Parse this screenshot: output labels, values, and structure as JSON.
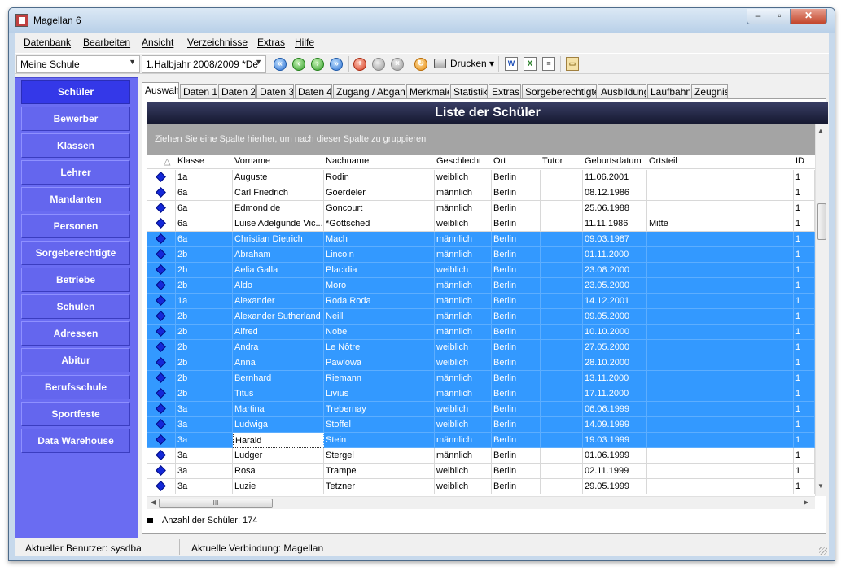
{
  "window": {
    "title": "Magellan 6"
  },
  "menu": [
    "Datenbank",
    "Bearbeiten",
    "Ansicht",
    "Verzeichnisse",
    "Extras",
    "Hilfe"
  ],
  "toolbar": {
    "school": "Meine Schule",
    "period": "1.Halbjahr 2008/2009 *De",
    "print_label": "Drucken"
  },
  "sidebar": {
    "active": "Schüler",
    "items": [
      "Schüler",
      "Bewerber",
      "Klassen",
      "Lehrer",
      "Mandanten",
      "Personen",
      "Sorgeberechtigte",
      "Betriebe",
      "Schulen",
      "Adressen",
      "Abitur",
      "Berufsschule",
      "Sportfeste",
      "Data Warehouse"
    ]
  },
  "tabs": {
    "active": "Auswahl",
    "items": [
      "Auswahl",
      "Daten 1",
      "Daten 2",
      "Daten 3",
      "Daten 4",
      "Zugang / Abgang",
      "Merkmale",
      "Statistik",
      "Extras",
      "Sorgeberechtigte",
      "Ausbildung",
      "Laufbahn",
      "Zeugnis"
    ]
  },
  "list": {
    "title": "Liste der Schüler",
    "group_hint": "Ziehen Sie eine Spalte hierher, um nach dieser Spalte zu gruppieren",
    "sort_indicator": "△",
    "columns": [
      "Klasse",
      "Vorname",
      "Nachname",
      "Geschlecht",
      "Ort",
      "Tutor",
      "Geburtsdatum",
      "Ortsteil",
      "ID"
    ],
    "rows": [
      {
        "klasse": "1a",
        "vorname": "Auguste",
        "nachname": "Rodin",
        "geschlecht": "weiblich",
        "ort": "Berlin",
        "tutor": "",
        "geburtsdatum": "11.06.2001",
        "ortsteil": "",
        "id": "1",
        "selected": false
      },
      {
        "klasse": "6a",
        "vorname": "Carl Friedrich",
        "nachname": "Goerdeler",
        "geschlecht": "männlich",
        "ort": "Berlin",
        "tutor": "",
        "geburtsdatum": "08.12.1986",
        "ortsteil": "",
        "id": "1",
        "selected": false
      },
      {
        "klasse": "6a",
        "vorname": "Edmond de",
        "nachname": "Goncourt",
        "geschlecht": "männlich",
        "ort": "Berlin",
        "tutor": "",
        "geburtsdatum": "25.06.1988",
        "ortsteil": "",
        "id": "1",
        "selected": false
      },
      {
        "klasse": "6a",
        "vorname": "Luise Adelgunde Vic...",
        "nachname": "*Gottsched",
        "geschlecht": "weiblich",
        "ort": "Berlin",
        "tutor": "",
        "geburtsdatum": "11.11.1986",
        "ortsteil": "Mitte",
        "id": "1",
        "selected": false
      },
      {
        "klasse": "6a",
        "vorname": "Christian Dietrich",
        "nachname": "Mach",
        "geschlecht": "männlich",
        "ort": "Berlin",
        "tutor": "",
        "geburtsdatum": "09.03.1987",
        "ortsteil": "",
        "id": "1",
        "selected": true
      },
      {
        "klasse": "2b",
        "vorname": "Abraham",
        "nachname": "Lincoln",
        "geschlecht": "männlich",
        "ort": "Berlin",
        "tutor": "",
        "geburtsdatum": "01.11.2000",
        "ortsteil": "",
        "id": "1",
        "selected": true
      },
      {
        "klasse": "2b",
        "vorname": "Aelia Galla",
        "nachname": "Placidia",
        "geschlecht": "weiblich",
        "ort": "Berlin",
        "tutor": "",
        "geburtsdatum": "23.08.2000",
        "ortsteil": "",
        "id": "1",
        "selected": true
      },
      {
        "klasse": "2b",
        "vorname": "Aldo",
        "nachname": "Moro",
        "geschlecht": "männlich",
        "ort": "Berlin",
        "tutor": "",
        "geburtsdatum": "23.05.2000",
        "ortsteil": "",
        "id": "1",
        "selected": true
      },
      {
        "klasse": "1a",
        "vorname": "Alexander",
        "nachname": "Roda Roda",
        "geschlecht": "männlich",
        "ort": "Berlin",
        "tutor": "",
        "geburtsdatum": "14.12.2001",
        "ortsteil": "",
        "id": "1",
        "selected": true
      },
      {
        "klasse": "2b",
        "vorname": "Alexander Sutherland",
        "nachname": "Neill",
        "geschlecht": "männlich",
        "ort": "Berlin",
        "tutor": "",
        "geburtsdatum": "09.05.2000",
        "ortsteil": "",
        "id": "1",
        "selected": true
      },
      {
        "klasse": "2b",
        "vorname": "Alfred",
        "nachname": "Nobel",
        "geschlecht": "männlich",
        "ort": "Berlin",
        "tutor": "",
        "geburtsdatum": "10.10.2000",
        "ortsteil": "",
        "id": "1",
        "selected": true
      },
      {
        "klasse": "2b",
        "vorname": "Andra",
        "nachname": "Le Nôtre",
        "geschlecht": "weiblich",
        "ort": "Berlin",
        "tutor": "",
        "geburtsdatum": "27.05.2000",
        "ortsteil": "",
        "id": "1",
        "selected": true
      },
      {
        "klasse": "2b",
        "vorname": "Anna",
        "nachname": "Pawlowa",
        "geschlecht": "weiblich",
        "ort": "Berlin",
        "tutor": "",
        "geburtsdatum": "28.10.2000",
        "ortsteil": "",
        "id": "1",
        "selected": true
      },
      {
        "klasse": "2b",
        "vorname": "Bernhard",
        "nachname": "Riemann",
        "geschlecht": "männlich",
        "ort": "Berlin",
        "tutor": "",
        "geburtsdatum": "13.11.2000",
        "ortsteil": "",
        "id": "1",
        "selected": true
      },
      {
        "klasse": "2b",
        "vorname": "Titus",
        "nachname": "Livius",
        "geschlecht": "männlich",
        "ort": "Berlin",
        "tutor": "",
        "geburtsdatum": "17.11.2000",
        "ortsteil": "",
        "id": "1",
        "selected": true
      },
      {
        "klasse": "3a",
        "vorname": "Martina",
        "nachname": "Trebernay",
        "geschlecht": "weiblich",
        "ort": "Berlin",
        "tutor": "",
        "geburtsdatum": "06.06.1999",
        "ortsteil": "",
        "id": "1",
        "selected": true
      },
      {
        "klasse": "3a",
        "vorname": "Ludwiga",
        "nachname": "Stoffel",
        "geschlecht": "weiblich",
        "ort": "Berlin",
        "tutor": "",
        "geburtsdatum": "14.09.1999",
        "ortsteil": "",
        "id": "1",
        "selected": true
      },
      {
        "klasse": "3a",
        "vorname": "Harald",
        "nachname": "Stein",
        "geschlecht": "männlich",
        "ort": "Berlin",
        "tutor": "",
        "geburtsdatum": "19.03.1999",
        "ortsteil": "",
        "id": "1",
        "selected": true,
        "focused": true
      },
      {
        "klasse": "3a",
        "vorname": "Ludger",
        "nachname": "Stergel",
        "geschlecht": "männlich",
        "ort": "Berlin",
        "tutor": "",
        "geburtsdatum": "01.06.1999",
        "ortsteil": "",
        "id": "1",
        "selected": false
      },
      {
        "klasse": "3a",
        "vorname": "Rosa",
        "nachname": "Trampe",
        "geschlecht": "weiblich",
        "ort": "Berlin",
        "tutor": "",
        "geburtsdatum": "02.11.1999",
        "ortsteil": "",
        "id": "1",
        "selected": false
      },
      {
        "klasse": "3a",
        "vorname": "Luzie",
        "nachname": "Tetzner",
        "geschlecht": "weiblich",
        "ort": "Berlin",
        "tutor": "",
        "geburtsdatum": "29.05.1999",
        "ortsteil": "",
        "id": "1",
        "selected": false
      }
    ],
    "count_label": "Anzahl der Schüler: 174"
  },
  "statusbar": {
    "user": "Aktueller Benutzer: sysdba",
    "connection": "Aktuelle Verbindung: Magellan"
  },
  "colors": {
    "sidebar": "#6a6cf2",
    "sidebar_active": "#3438e8",
    "selection": "#3399ff",
    "title_bar": "#1c1f3a",
    "group_box": "#a4a4a4"
  }
}
